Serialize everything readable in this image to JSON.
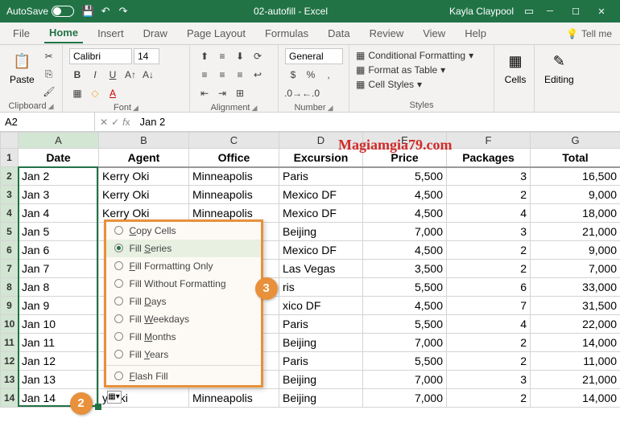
{
  "titlebar": {
    "autosave": "AutoSave",
    "title": "02-autofill - Excel",
    "user": "Kayla Claypool"
  },
  "tabs": [
    "File",
    "Home",
    "Insert",
    "Draw",
    "Page Layout",
    "Formulas",
    "Data",
    "Review",
    "View",
    "Help"
  ],
  "tellme": "Tell me",
  "ribbon": {
    "clipboard": {
      "paste": "Paste",
      "label": "Clipboard"
    },
    "font": {
      "name": "Calibri",
      "size": "14",
      "label": "Font"
    },
    "alignment": {
      "label": "Alignment"
    },
    "number": {
      "format": "General",
      "label": "Number"
    },
    "styles": {
      "cond": "Conditional Formatting",
      "table": "Format as Table",
      "cell": "Cell Styles",
      "label": "Styles"
    },
    "cells": {
      "label": "Cells"
    },
    "editing": {
      "label": "Editing"
    }
  },
  "namebox": "A2",
  "formula": "Jan 2",
  "watermark": "Magiamgia79.com",
  "columns": [
    "A",
    "B",
    "C",
    "D",
    "E",
    "F",
    "G"
  ],
  "headers": [
    "Date",
    "Agent",
    "Office",
    "Excursion",
    "Price",
    "Packages",
    "Total"
  ],
  "rows": [
    {
      "n": 2,
      "date": "Jan 2",
      "agent": "Kerry Oki",
      "office": "Minneapolis",
      "exc": "Paris",
      "price": "5,500",
      "pkg": "3",
      "total": "16,500"
    },
    {
      "n": 3,
      "date": "Jan 3",
      "agent": "Kerry Oki",
      "office": "Minneapolis",
      "exc": "Mexico DF",
      "price": "4,500",
      "pkg": "2",
      "total": "9,000"
    },
    {
      "n": 4,
      "date": "Jan 4",
      "agent": "Kerry Oki",
      "office": "Minneapolis",
      "exc": "Mexico DF",
      "price": "4,500",
      "pkg": "4",
      "total": "18,000"
    },
    {
      "n": 5,
      "date": "Jan 5",
      "agent": "",
      "office": "olis",
      "exc": "Beijing",
      "price": "7,000",
      "pkg": "3",
      "total": "21,000"
    },
    {
      "n": 6,
      "date": "Jan 6",
      "agent": "",
      "office": "olis",
      "exc": "Mexico DF",
      "price": "4,500",
      "pkg": "2",
      "total": "9,000"
    },
    {
      "n": 7,
      "date": "Jan 7",
      "agent": "",
      "office": "olis",
      "exc": "Las Vegas",
      "price": "3,500",
      "pkg": "2",
      "total": "7,000"
    },
    {
      "n": 8,
      "date": "Jan 8",
      "agent": "",
      "office": "olis",
      "exc": "ris",
      "price": "5,500",
      "pkg": "6",
      "total": "33,000"
    },
    {
      "n": 9,
      "date": "Jan 9",
      "agent": "",
      "office": "olis",
      "exc": "xico DF",
      "price": "4,500",
      "pkg": "7",
      "total": "31,500"
    },
    {
      "n": 10,
      "date": "Jan 10",
      "agent": "",
      "office": "olis",
      "exc": "Paris",
      "price": "5,500",
      "pkg": "4",
      "total": "22,000"
    },
    {
      "n": 11,
      "date": "Jan 11",
      "agent": "",
      "office": "olis",
      "exc": "Beijing",
      "price": "7,000",
      "pkg": "2",
      "total": "14,000"
    },
    {
      "n": 12,
      "date": "Jan 12",
      "agent": "",
      "office": "olis",
      "exc": "Paris",
      "price": "5,500",
      "pkg": "2",
      "total": "11,000"
    },
    {
      "n": 13,
      "date": "Jan 13",
      "agent": "",
      "office": "olis",
      "exc": "Beijing",
      "price": "7,000",
      "pkg": "3",
      "total": "21,000"
    },
    {
      "n": 14,
      "date": "Jan 14",
      "agent": "y Oki",
      "office": "Minneapolis",
      "exc": "Beijing",
      "price": "7,000",
      "pkg": "2",
      "total": "14,000"
    }
  ],
  "menu": {
    "items": [
      {
        "label": "Copy Cells",
        "accel": "C",
        "sel": false
      },
      {
        "label": "Fill Series",
        "accel": "S",
        "sel": true
      },
      {
        "label": "Fill Formatting Only",
        "accel": "F",
        "sel": false
      },
      {
        "label": "Fill Without Formatting",
        "accel": "O",
        "sel": false
      },
      {
        "label": "Fill Days",
        "accel": "D",
        "sel": false
      },
      {
        "label": "Fill Weekdays",
        "accel": "W",
        "sel": false
      },
      {
        "label": "Fill Months",
        "accel": "M",
        "sel": false
      },
      {
        "label": "Fill Years",
        "accel": "Y",
        "sel": false
      },
      {
        "label": "Flash Fill",
        "accel": "F",
        "sel": false
      }
    ]
  },
  "bubbles": {
    "b2": "2",
    "b3": "3"
  }
}
